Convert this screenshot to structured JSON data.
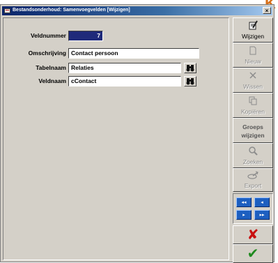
{
  "window": {
    "title": "Bestandsonderhoud: Samenvoegvelden [Wijzigen]",
    "close_symbol": "×"
  },
  "corner_glyph": "K",
  "form": {
    "veldnummer": {
      "label": "Veldnummer",
      "value": "7"
    },
    "omschrijving": {
      "label": "Omschrijving",
      "value": "Contact persoon"
    },
    "tabelnaam": {
      "label": "Tabelnaam",
      "value": "Relaties"
    },
    "veldnaam": {
      "label": "Veldnaam",
      "value": "cContact"
    }
  },
  "toolbar": {
    "wijzigen": "Wijzigen",
    "nieuw": "Nieuw",
    "wissen": "Wissen",
    "kopieren": "Kopiëren",
    "groeps_line1": "Groeps",
    "groeps_line2": "wijzigen",
    "zoeken": "Zoeken",
    "export": "Export"
  },
  "navigation": {
    "first": "◂◂",
    "prev": "◂",
    "next": "▸",
    "last": "▸▸"
  },
  "actions": {
    "cancel": "✘",
    "ok": "✔"
  },
  "icons": {
    "lookup": "binoculars-icon",
    "wijzigen": "edit-document-icon",
    "nieuw": "new-document-icon",
    "wissen": "delete-x-icon",
    "kopieren": "copy-icon",
    "zoeken": "search-icon",
    "export": "export-icon"
  },
  "colors": {
    "titlebar": "#0a246a",
    "selected_field": "#1f2a7a",
    "cancel": "#c81010",
    "ok": "#1f8a1f",
    "nav": "#1d5fc0"
  }
}
